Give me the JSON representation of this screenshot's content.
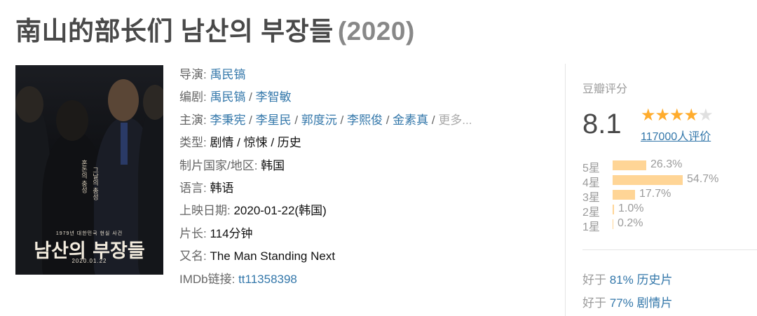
{
  "title": {
    "main": "南山的部长们 남산의 부장들",
    "year": "(2020)"
  },
  "poster": {
    "tagline_top": "1979년 대한민국 현실 사건",
    "title_text": "남산의 부장들",
    "date_text": "2020.01.22",
    "side_text_1": "혼돈의 충성",
    "side_text_2": "그날의 총성"
  },
  "info": {
    "director": {
      "label": "导演: ",
      "names": [
        "禹民镐"
      ]
    },
    "writer": {
      "label": "编剧: ",
      "names": [
        "禹民镐",
        "李智敏"
      ]
    },
    "cast": {
      "label": "主演: ",
      "names": [
        "李秉宪",
        "李星民",
        "郭度沅",
        "李熙俊",
        "金素真"
      ],
      "more": "更多..."
    },
    "genre": {
      "label": "类型: ",
      "value": "剧情 / 惊悚 / 历史"
    },
    "country": {
      "label": "制片国家/地区: ",
      "value": "韩国"
    },
    "language": {
      "label": "语言: ",
      "value": "韩语"
    },
    "release": {
      "label": "上映日期: ",
      "value": "2020-01-22(韩国)"
    },
    "runtime": {
      "label": "片长: ",
      "value": "114分钟"
    },
    "aka": {
      "label": "又名: ",
      "value": "The Man Standing Next"
    },
    "imdb": {
      "label": "IMDb链接: ",
      "value": "tt11358398"
    },
    "separator": " / "
  },
  "rating": {
    "label": "豆瓣评分",
    "score": "8.1",
    "stars_filled": 4,
    "stars_total": 5,
    "count": "117000人评价",
    "breakdown": [
      {
        "level": "5星",
        "percent": "26.3%",
        "value": 26.3
      },
      {
        "level": "4星",
        "percent": "54.7%",
        "value": 54.7
      },
      {
        "level": "3星",
        "percent": "17.7%",
        "value": 17.7
      },
      {
        "level": "2星",
        "percent": "1.0%",
        "value": 1.0
      },
      {
        "level": "1星",
        "percent": "0.2%",
        "value": 0.2
      }
    ],
    "better_than": [
      {
        "prefix": "好于 ",
        "link": "81% 历史片"
      },
      {
        "prefix": "好于 ",
        "link": "77% 剧情片"
      }
    ]
  },
  "colors": {
    "link": "#3377aa",
    "star": "#ffac2d",
    "bar": "#ffd596",
    "title": "#494949"
  }
}
